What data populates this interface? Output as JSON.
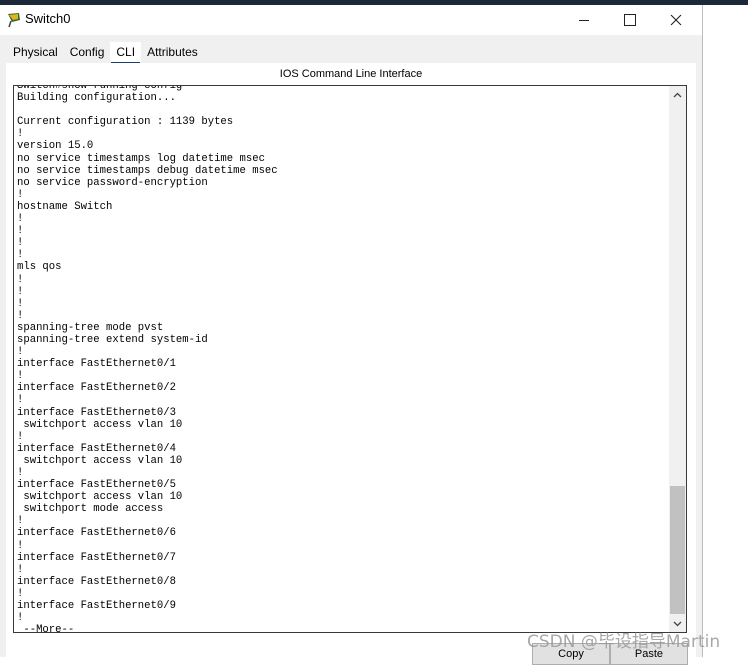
{
  "window": {
    "title": "Switch0",
    "controls": {
      "minimize_icon": "minimize-icon",
      "maximize_icon": "maximize-icon",
      "close_icon": "close-icon"
    }
  },
  "tabs": [
    {
      "label": "Physical",
      "active": false
    },
    {
      "label": "Config",
      "active": false
    },
    {
      "label": "CLI",
      "active": true
    },
    {
      "label": "Attributes",
      "active": false
    }
  ],
  "cli": {
    "heading": "IOS Command Line Interface",
    "output": "Switch#show running-config\nBuilding configuration...\n\nCurrent configuration : 1139 bytes\n!\nversion 15.0\nno service timestamps log datetime msec\nno service timestamps debug datetime msec\nno service password-encryption\n!\nhostname Switch\n!\n!\n!\n!\nmls qos\n!\n!\n!\n!\nspanning-tree mode pvst\nspanning-tree extend system-id\n!\ninterface FastEthernet0/1\n!\ninterface FastEthernet0/2\n!\ninterface FastEthernet0/3\n switchport access vlan 10\n!\ninterface FastEthernet0/4\n switchport access vlan 10\n!\ninterface FastEthernet0/5\n switchport access vlan 10\n switchport mode access\n!\ninterface FastEthernet0/6\n!\ninterface FastEthernet0/7\n!\ninterface FastEthernet0/8\n!\ninterface FastEthernet0/9\n!\n --More--"
  },
  "buttons": {
    "copy": "Copy",
    "paste": "Paste"
  },
  "watermark": "CSDN @毕设指导Martin",
  "colors": {
    "tab_underline": "#1a3f73",
    "desktop_strip": "#1b2838"
  }
}
